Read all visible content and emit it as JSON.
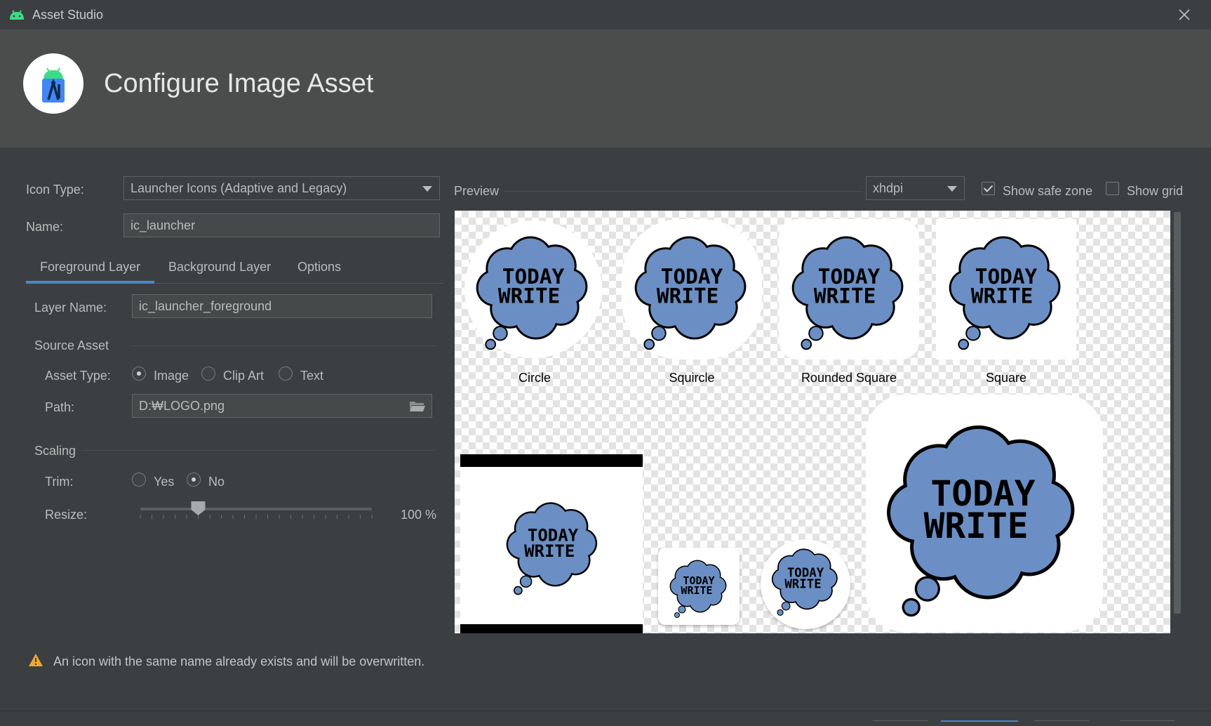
{
  "window": {
    "title": "Asset Studio"
  },
  "header": {
    "title": "Configure Image Asset"
  },
  "form": {
    "icon_type_label": "Icon Type:",
    "icon_type_value": "Launcher Icons (Adaptive and Legacy)",
    "name_label": "Name:",
    "name_value": "ic_launcher"
  },
  "tabs": [
    {
      "label": "Foreground Layer",
      "selected": true
    },
    {
      "label": "Background Layer",
      "selected": false
    },
    {
      "label": "Options",
      "selected": false
    }
  ],
  "layer": {
    "layer_name_label": "Layer Name:",
    "layer_name_value": "ic_launcher_foreground",
    "source_asset_title": "Source Asset",
    "asset_type_label": "Asset Type:",
    "asset_type_options": [
      "Image",
      "Clip Art",
      "Text"
    ],
    "asset_type_selected": "Image",
    "path_label": "Path:",
    "path_value": "D:₩LOGO.png",
    "scaling_title": "Scaling",
    "trim_label": "Trim:",
    "trim_options": [
      "Yes",
      "No"
    ],
    "trim_selected": "No",
    "resize_label": "Resize:",
    "resize_value": "100 %",
    "resize_slider_fraction": 0.25
  },
  "preview": {
    "label": "Preview",
    "density_value": "xhdpi",
    "show_safe_zone_label": "Show safe zone",
    "show_safe_zone_checked": true,
    "show_grid_label": "Show grid",
    "show_grid_checked": false,
    "shape_labels": [
      "Circle",
      "Squircle",
      "Rounded Square",
      "Square"
    ],
    "logo_text_line1": "TODAY",
    "logo_text_line2": "WRITE"
  },
  "warning": {
    "text": "An icon with the same name already exists and will be overwritten."
  },
  "colors": {
    "accent": "#4a88c7",
    "logo_blue": "#6b8fc4",
    "warning": "#f0a732"
  }
}
